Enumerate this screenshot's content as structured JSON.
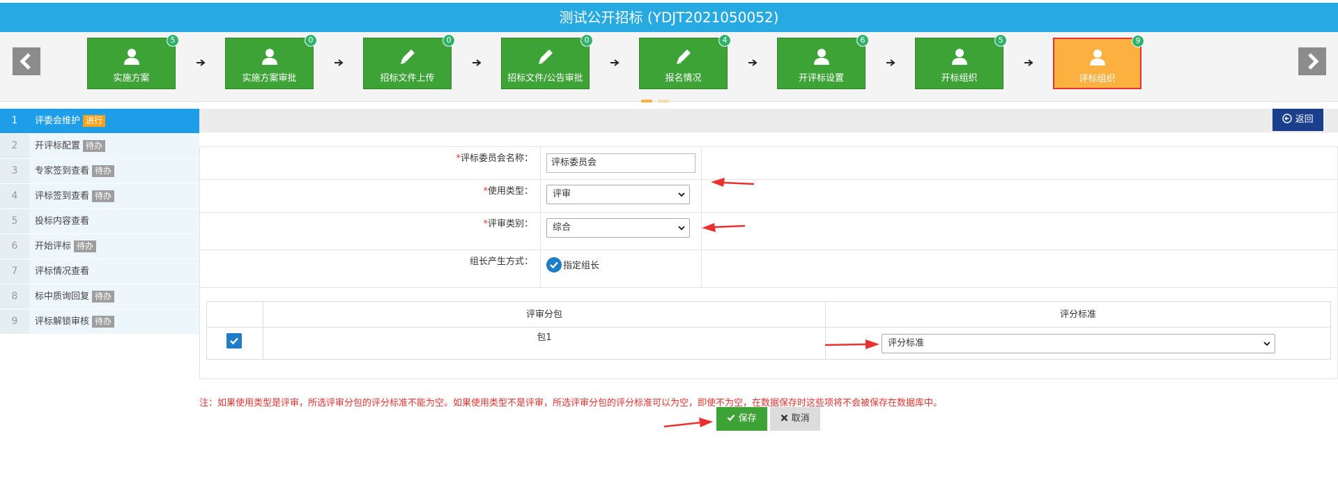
{
  "title": "测试公开招标 (YDJT2021050052)",
  "nav": {
    "prev_icon": "chevron-left-icon",
    "next_icon": "chevron-right-icon"
  },
  "steps": [
    {
      "label": "实施方案",
      "badge": "5",
      "icon": "user-icon"
    },
    {
      "label": "实施方案审批",
      "badge": "0",
      "icon": "user-icon"
    },
    {
      "label": "招标文件上传",
      "badge": "0",
      "icon": "pencil-icon"
    },
    {
      "label": "招标文件/公告审批",
      "badge": "0",
      "icon": "pencil-icon"
    },
    {
      "label": "报名情况",
      "badge": "4",
      "icon": "pencil-icon"
    },
    {
      "label": "开评标设置",
      "badge": "6",
      "icon": "user-icon"
    },
    {
      "label": "开标组织",
      "badge": "5",
      "icon": "user-icon"
    },
    {
      "label": "评标组织",
      "badge": "9",
      "icon": "user-icon",
      "active": true
    }
  ],
  "sidebar": {
    "items": [
      {
        "num": "1",
        "label": "评委会维护",
        "tag": "进行",
        "active": true
      },
      {
        "num": "2",
        "label": "开评标配置",
        "tag": "待办"
      },
      {
        "num": "3",
        "label": "专家签到查看",
        "tag": "待办"
      },
      {
        "num": "4",
        "label": "评标签到查看",
        "tag": "待办"
      },
      {
        "num": "5",
        "label": "投标内容查看",
        "tag": ""
      },
      {
        "num": "6",
        "label": "开始评标",
        "tag": "待办"
      },
      {
        "num": "7",
        "label": "评标情况查看",
        "tag": ""
      },
      {
        "num": "8",
        "label": "标中质询回复",
        "tag": "待办"
      },
      {
        "num": "9",
        "label": "评标解锁审核",
        "tag": "待办"
      }
    ]
  },
  "back_label": "返回",
  "form": {
    "required_mark": "*",
    "committee_name_label": "评标委员会名称：",
    "committee_name_value": "评标委员会",
    "usage_type_label": "使用类型：",
    "usage_type_value": "评审",
    "review_category_label": "评审类别：",
    "review_category_value": "综合",
    "leader_method_label": "组长产生方式：",
    "leader_method_value": "指定组长"
  },
  "package_table": {
    "headers": [
      "评审分包",
      "评分标准"
    ],
    "rows": [
      {
        "package": "包1",
        "standard": "评分标准",
        "checked": true
      }
    ]
  },
  "note": "注：如果使用类型是评审，所选评审分包的评分标准不能为空。如果使用类型不是评审，所选评审分包的评分标准可以为空，即使不为空，在数据保存时这些项将不会被保存在数据库中。",
  "buttons": {
    "save": "保存",
    "cancel": "取消"
  },
  "colors": {
    "header_blue": "#27a9e1",
    "step_green": "#3ea337",
    "step_active": "#fbb040",
    "alert_red": "#e8312e",
    "sidebar_active": "#1e9ee8"
  }
}
